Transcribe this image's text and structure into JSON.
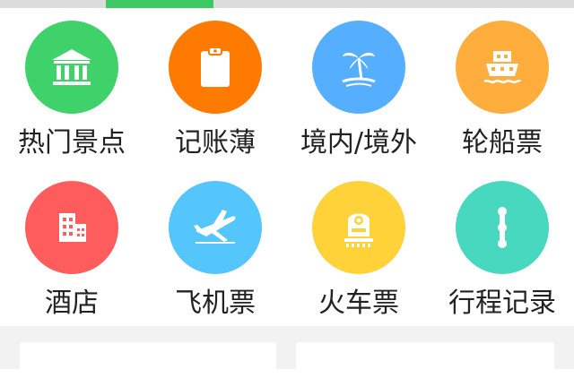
{
  "tabs": {
    "active_index": 1,
    "active_color": "#3cc862"
  },
  "grid": {
    "items": [
      {
        "label": "热门景点",
        "icon": "bank-icon",
        "color": "#3fd26a"
      },
      {
        "label": "记账薄",
        "icon": "clipboard-icon",
        "color": "#ff7a00"
      },
      {
        "label": "境内/境外",
        "icon": "palm-tree-icon",
        "color": "#55aefe"
      },
      {
        "label": "轮船票",
        "icon": "ship-icon",
        "color": "#ffae3d"
      },
      {
        "label": "酒店",
        "icon": "hotel-icon",
        "color": "#ff5d5d"
      },
      {
        "label": "飞机票",
        "icon": "airplane-icon",
        "color": "#54c6fb"
      },
      {
        "label": "火车票",
        "icon": "train-icon",
        "color": "#ffd23a"
      },
      {
        "label": "行程记录",
        "icon": "itinerary-icon",
        "color": "#48d8c0"
      }
    ]
  },
  "cards": [
    {
      "accent": "#e94e3c"
    },
    {
      "accent": "#e94e3c"
    }
  ]
}
